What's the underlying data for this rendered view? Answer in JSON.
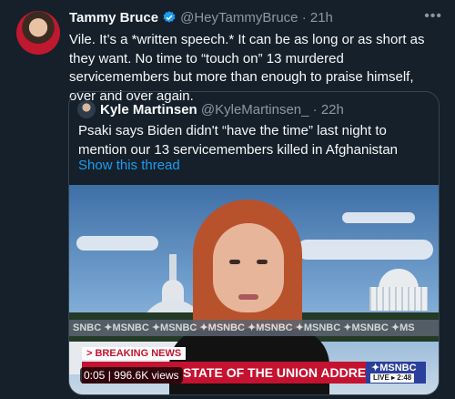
{
  "tweet": {
    "author_name": "Tammy Bruce",
    "handle": "@HeyTammyBruce",
    "separator": "·",
    "time": "21h",
    "more": "•••",
    "text": "Vile. It’s a *written speech.* It can be as long or as short as they want. No time to “touch on” 13 murdered servicemembers but more than enough to praise himself, over and over again."
  },
  "quoted": {
    "author_name": "Kyle Martinsen",
    "handle": "@KyleMartinsen_",
    "separator": "·",
    "time": "22h",
    "text": "Psaki says Biden didn't “have the time” last night to mention our 13 servicemembers killed in Afghanistan",
    "thread_link": "Show this thread"
  },
  "video": {
    "ticker_text": "SNBC  ✦MSNBC  ✦MSNBC  ✦MSNBC  ✦MSNBC  ✦MSNBC  ✦MSNBC  ✦MS",
    "breaking_label": "> BREAKING NEWS",
    "headline": "STATE OF THE UNION ADDRESS",
    "network": "MSNBC",
    "live_text": "LIVE ▸ 2:48",
    "timestamp": "0:05",
    "views": "996.6K views",
    "pill_sep": "|"
  },
  "colors": {
    "background": "#15202b",
    "text_primary": "#f7f9f9",
    "text_muted": "#8b98a5",
    "link": "#1d9bf0",
    "verified": "#1d9bf0",
    "breaking_red": "#c41230",
    "msnbc_blue": "#2b3f9c"
  }
}
